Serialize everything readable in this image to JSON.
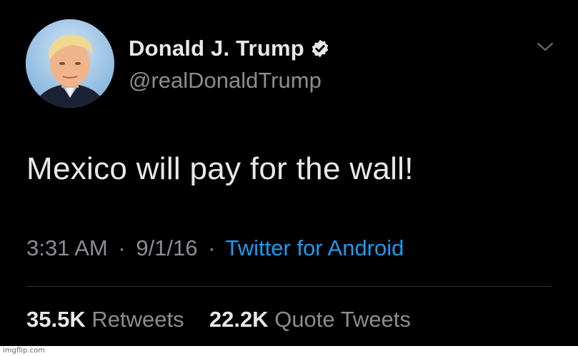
{
  "tweet": {
    "display_name": "Donald J. Trump",
    "handle": "@realDonaldTrump",
    "verified": true,
    "text": "Mexico will pay for the wall!",
    "time": "3:31 AM",
    "date": "9/1/16",
    "separator": "·",
    "source": "Twitter for Android",
    "retweets_count": "35.5K",
    "retweets_label": "Retweets",
    "quote_tweets_count": "22.2K",
    "quote_tweets_label": "Quote Tweets"
  },
  "icons": {
    "verified": "verified-badge-icon",
    "more": "chevron-down-icon"
  },
  "watermark": "imgflip.com",
  "colors": {
    "background": "#000000",
    "primary_text": "#e8e8e8",
    "secondary_text": "#8a8d91",
    "link": "#1d9bf0"
  }
}
